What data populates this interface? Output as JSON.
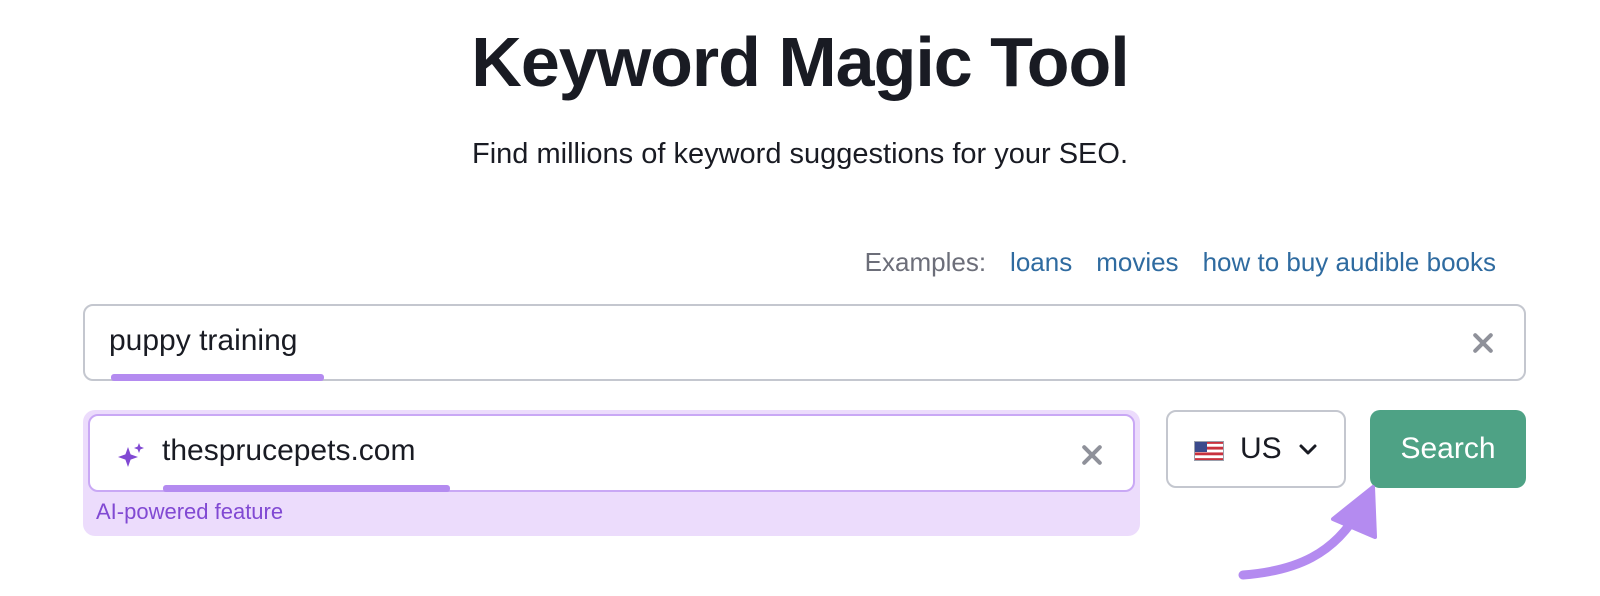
{
  "header": {
    "title": "Keyword Magic Tool",
    "subtitle": "Find millions of keyword suggestions for your SEO."
  },
  "examples": {
    "label": "Examples:",
    "links": [
      "loans",
      "movies",
      "how to buy audible books"
    ]
  },
  "keyword_input": {
    "value": "puppy training",
    "clear_icon": "close-icon"
  },
  "domain_input": {
    "icon": "sparkle-icon",
    "value": "thesprucepets.com",
    "clear_icon": "close-icon",
    "caption": "AI-powered feature"
  },
  "country_select": {
    "flag_icon": "us-flag-icon",
    "selected": "US",
    "chevron_icon": "chevron-down-icon"
  },
  "search_button": {
    "label": "Search"
  },
  "colors": {
    "accent_purple": "#b48bf0",
    "ai_background": "#ecdcfc",
    "ai_caption": "#8149d3",
    "search_green": "#4ea285",
    "link_blue": "#2f6ba0"
  }
}
